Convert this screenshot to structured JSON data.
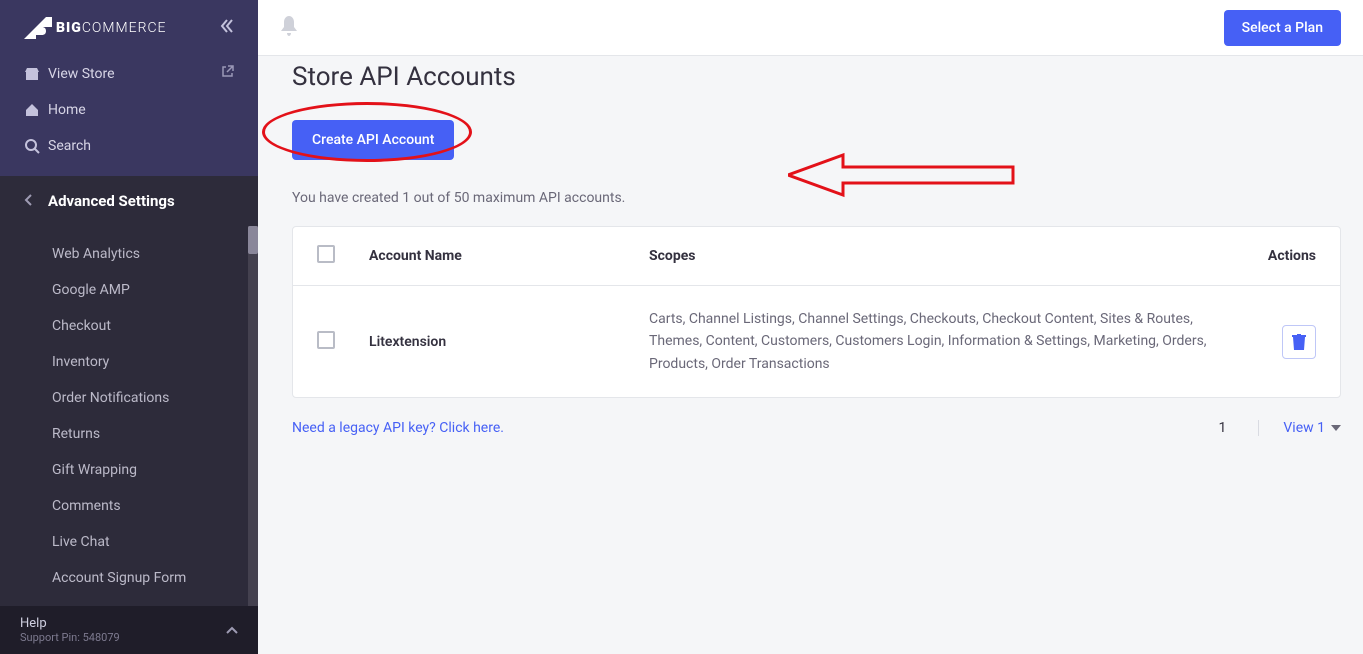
{
  "brand": {
    "name_left": "BIG",
    "name_right": "COMMERCE"
  },
  "sidebar": {
    "top": [
      {
        "label": "View Store"
      },
      {
        "label": "Home"
      },
      {
        "label": "Search"
      }
    ],
    "section_title": "Advanced Settings",
    "items": [
      {
        "label": "Web Analytics"
      },
      {
        "label": "Google AMP"
      },
      {
        "label": "Checkout"
      },
      {
        "label": "Inventory"
      },
      {
        "label": "Order Notifications"
      },
      {
        "label": "Returns"
      },
      {
        "label": "Gift Wrapping"
      },
      {
        "label": "Comments"
      },
      {
        "label": "Live Chat"
      },
      {
        "label": "Account Signup Form"
      }
    ],
    "help_label": "Help",
    "support_pin": "Support Pin: 548079"
  },
  "topbar": {
    "plan_button": "Select a Plan"
  },
  "page": {
    "title": "Store API Accounts",
    "create_button": "Create API Account",
    "created_text": "You have created 1 out of 50 maximum API accounts.",
    "table": {
      "headers": {
        "name": "Account Name",
        "scopes": "Scopes",
        "actions": "Actions"
      },
      "rows": [
        {
          "name": "Litextension",
          "scopes": "Carts, Channel Listings, Channel Settings, Checkouts, Checkout Content, Sites & Routes, Themes, Content, Customers, Customers Login, Information & Settings, Marketing, Orders, Products, Order Transactions"
        }
      ]
    },
    "legacy_link": "Need a legacy API key? Click here.",
    "pagination": {
      "page": "1",
      "view_label": "View 1"
    }
  }
}
